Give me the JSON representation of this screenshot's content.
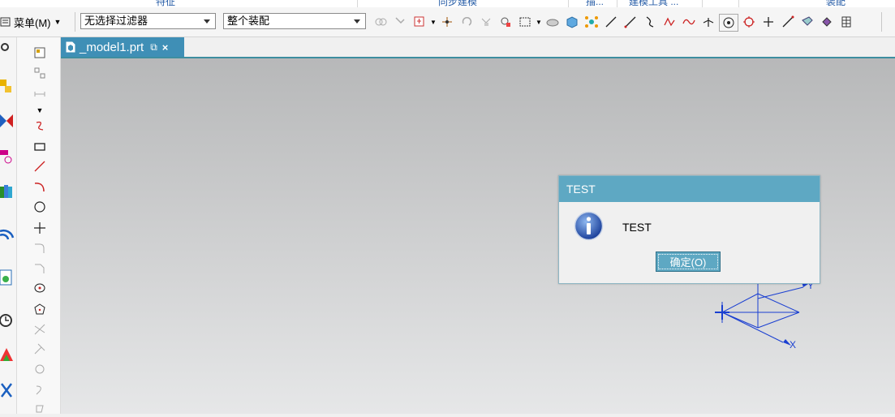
{
  "ribbon": {
    "group_labels": [
      "特征",
      "同步建模",
      "描...",
      "建模工具 ...",
      "装配"
    ]
  },
  "toolbar": {
    "menu_label": "菜单(M)",
    "filter_combo_value": "无选择过滤器",
    "scope_combo_value": "整个装配",
    "tool_icons": [
      "select-icon",
      "snap-icon",
      "point-snap-icon",
      "move-icon",
      "rotate-icon",
      "align-icon",
      "component-icon",
      "box-select-icon",
      "shade-icon",
      "solid-icon",
      "nodes-icon",
      "line-icon",
      "line2-icon",
      "curve-icon",
      "spline-icon",
      "wave-icon",
      "axis-icon",
      "circle-target-icon",
      "circle-icon",
      "cross-icon",
      "line3-icon",
      "view-icon",
      "cube-icon",
      "grid-icon"
    ]
  },
  "tab": {
    "name": "_model1.prt",
    "close_glyph": "×"
  },
  "dialog": {
    "title": "TEST",
    "message": "TEST",
    "ok_label": "确定(O)"
  },
  "axis": {
    "x_label": "X",
    "y_label": "Y"
  },
  "colors": {
    "accent": "#5ea8c3",
    "tab": "#3f8fb6",
    "axis": "#1a3fd1"
  }
}
